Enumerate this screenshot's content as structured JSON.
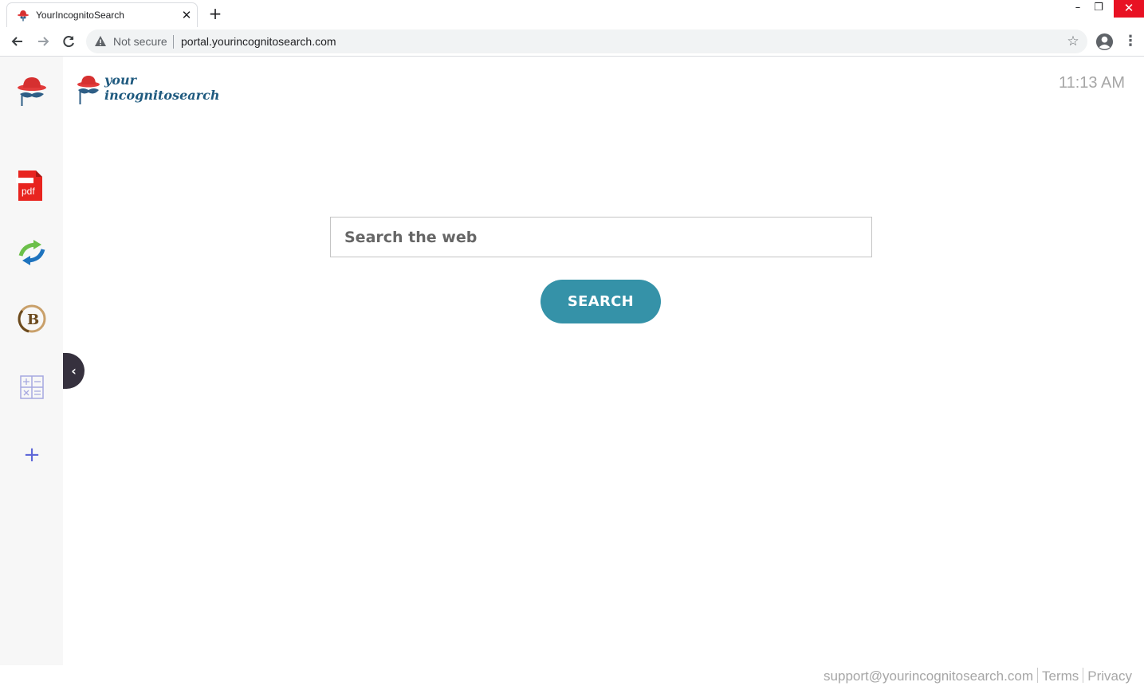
{
  "browser": {
    "tab_title": "YourIncognitoSearch",
    "tab_close": "✕",
    "new_tab": "+",
    "security_label": "Not secure",
    "url": "portal.yourincognitosearch.com",
    "window_controls": {
      "minimize": "–",
      "maximize": "❐",
      "close": "✕"
    },
    "icons": [
      "back-arrow-icon",
      "forward-arrow-icon",
      "reload-icon",
      "warning-icon",
      "star-icon",
      "profile-icon",
      "kebab-menu-icon"
    ]
  },
  "header": {
    "logo_line1": "your",
    "logo_line2": "incognitosearch",
    "time": "11:13 AM"
  },
  "sidebar": {
    "items": [
      {
        "name": "incognito-hat-icon"
      },
      {
        "name": "pdf-icon",
        "label": "pdf"
      },
      {
        "name": "convert-arrows-icon"
      },
      {
        "name": "bitcoin-icon",
        "label": "B"
      },
      {
        "name": "calculator-icon"
      },
      {
        "name": "add-icon",
        "label": "+"
      }
    ],
    "collapse_label": "‹"
  },
  "search": {
    "placeholder": "Search the web",
    "button_label": "SEARCH"
  },
  "footer": {
    "support_email": "support@yourincognitosearch.com",
    "terms": "Terms",
    "privacy": "Privacy"
  },
  "colors": {
    "search_button": "#3592a8",
    "logo_blue": "#1f5a7f",
    "hat_red": "#e23b3b",
    "collapse_tab": "#36313e"
  }
}
